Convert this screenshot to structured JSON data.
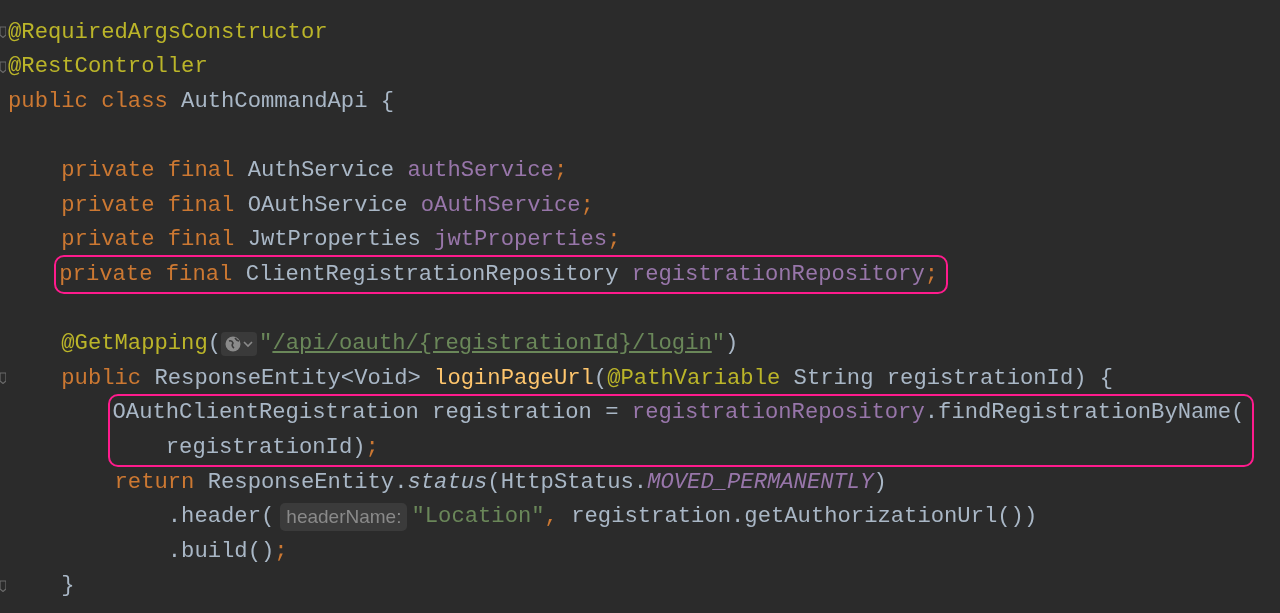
{
  "editor": {
    "blocks": [
      {
        "highlighted": false,
        "lines": [
          {
            "kind": "code",
            "fold_marker": true,
            "tokens": [
              {
                "kind": "annotation",
                "text": "@RequiredArgsConstructor"
              }
            ]
          },
          {
            "kind": "code",
            "fold_marker": true,
            "tokens": [
              {
                "kind": "annotation",
                "text": "@RestController"
              }
            ]
          },
          {
            "kind": "code",
            "fold_marker": false,
            "tokens": [
              {
                "kind": "keyword",
                "text": "public class "
              },
              {
                "kind": "plain",
                "text": "AuthCommandApi {"
              }
            ]
          },
          {
            "kind": "blank",
            "fold_marker": false
          },
          {
            "kind": "code",
            "fold_marker": false,
            "tokens": [
              {
                "kind": "keyword",
                "text": "    private final "
              },
              {
                "kind": "plain",
                "text": "AuthService "
              },
              {
                "kind": "field",
                "text": "authService"
              },
              {
                "kind": "punct",
                "text": ";"
              }
            ]
          },
          {
            "kind": "code",
            "fold_marker": false,
            "tokens": [
              {
                "kind": "keyword",
                "text": "    private final "
              },
              {
                "kind": "plain",
                "text": "OAuthService "
              },
              {
                "kind": "field",
                "text": "oAuthService"
              },
              {
                "kind": "punct",
                "text": ";"
              }
            ]
          },
          {
            "kind": "code",
            "fold_marker": false,
            "tokens": [
              {
                "kind": "keyword",
                "text": "    private final "
              },
              {
                "kind": "plain",
                "text": "JwtProperties "
              },
              {
                "kind": "field",
                "text": "jwtProperties"
              },
              {
                "kind": "punct",
                "text": ";"
              }
            ]
          }
        ]
      },
      {
        "highlighted": true,
        "lines": [
          {
            "kind": "code",
            "fold_marker": false,
            "tokens": [
              {
                "kind": "keyword",
                "text": "    private final "
              },
              {
                "kind": "plain",
                "text": "ClientRegistrationRepository "
              },
              {
                "kind": "field",
                "text": "registrationRepository"
              },
              {
                "kind": "punct",
                "text": ";"
              }
            ]
          }
        ]
      },
      {
        "highlighted": false,
        "lines": [
          {
            "kind": "blank",
            "fold_marker": false
          },
          {
            "kind": "code",
            "fold_marker": false,
            "tokens": [
              {
                "kind": "annotation",
                "text": "    @GetMapping"
              },
              {
                "kind": "plain",
                "text": "("
              },
              {
                "kind": "globe"
              },
              {
                "kind": "string",
                "text": "\""
              },
              {
                "kind": "link",
                "text": "/api/oauth/{registrationId}/login"
              },
              {
                "kind": "string",
                "text": "\""
              },
              {
                "kind": "plain",
                "text": ")"
              }
            ]
          },
          {
            "kind": "code",
            "fold_marker": true,
            "tokens": [
              {
                "kind": "keyword",
                "text": "    public "
              },
              {
                "kind": "plain",
                "text": "ResponseEntity<Void> "
              },
              {
                "kind": "method",
                "text": "loginPageUrl"
              },
              {
                "kind": "plain",
                "text": "("
              },
              {
                "kind": "annotation",
                "text": "@PathVariable "
              },
              {
                "kind": "plain",
                "text": "String registrationId) {"
              }
            ]
          }
        ]
      },
      {
        "highlighted": true,
        "lines": [
          {
            "kind": "code",
            "fold_marker": false,
            "tokens": [
              {
                "kind": "plain",
                "text": "        OAuthClientRegistration registration = "
              },
              {
                "kind": "field",
                "text": "registrationRepository"
              },
              {
                "kind": "plain",
                "text": ".findRegistrationByName("
              }
            ]
          },
          {
            "kind": "code",
            "fold_marker": false,
            "tokens": [
              {
                "kind": "plain",
                "text": "            registrationId)"
              },
              {
                "kind": "punct",
                "text": ";"
              }
            ]
          }
        ]
      },
      {
        "highlighted": false,
        "lines": [
          {
            "kind": "code",
            "fold_marker": false,
            "tokens": [
              {
                "kind": "keyword",
                "text": "        return "
              },
              {
                "kind": "plain",
                "text": "ResponseEntity."
              },
              {
                "kind": "static",
                "text": "status"
              },
              {
                "kind": "plain",
                "text": "(HttpStatus."
              },
              {
                "kind": "constant",
                "text": "MOVED_PERMANENTLY"
              },
              {
                "kind": "plain",
                "text": ")"
              }
            ]
          },
          {
            "kind": "code",
            "fold_marker": false,
            "tokens": [
              {
                "kind": "plain",
                "text": "            .header("
              },
              {
                "kind": "hint",
                "text": "headerName:"
              },
              {
                "kind": "string",
                "text": "\"Location\""
              },
              {
                "kind": "punct",
                "text": ", "
              },
              {
                "kind": "plain",
                "text": "registration.getAuthorizationUrl())"
              }
            ]
          },
          {
            "kind": "code",
            "fold_marker": false,
            "tokens": [
              {
                "kind": "plain",
                "text": "            .build()"
              },
              {
                "kind": "punct",
                "text": ";"
              }
            ]
          },
          {
            "kind": "code",
            "fold_marker": true,
            "tokens": [
              {
                "kind": "plain",
                "text": "    }"
              }
            ]
          }
        ]
      }
    ]
  }
}
